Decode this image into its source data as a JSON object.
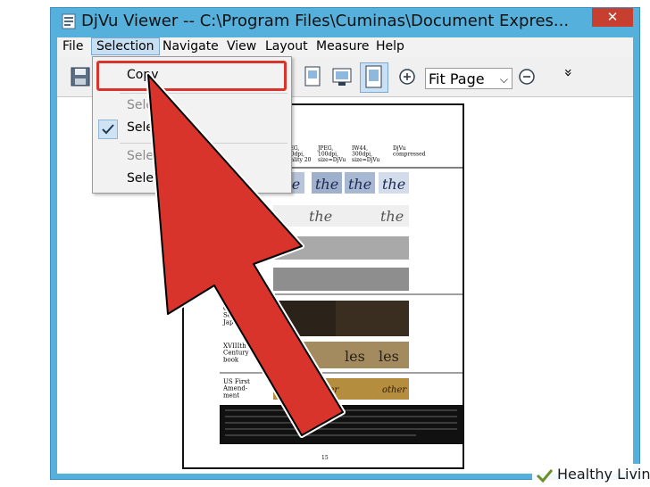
{
  "window": {
    "title": "DjVu Viewer -- C:\\Program Files\\Cuminas\\Document Expres...",
    "close_symbol": "✕"
  },
  "menubar": {
    "items": [
      "File",
      "Selection",
      "Navigate",
      "View",
      "Layout",
      "Measure",
      "Help"
    ]
  },
  "toolbar": {
    "zoom_value": "Fit Page",
    "zoom_chevron": "⌵",
    "overflow_symbol": "»"
  },
  "selection_menu": {
    "copy_label": "Copy",
    "item2_label": "Select",
    "item3_label": "Select",
    "item4_label": "Select",
    "item5_label": "Select"
  },
  "document": {
    "col1": "JPEG,\n300dpi,\nquality 20",
    "col2": "JPEG,\n100dpi,\nsize=DjVu",
    "col3": "IW44,\n300dpi,\nsize=DjVu",
    "col4": "DjVu\ncompressed",
    "row_words": [
      "the",
      "the",
      "the",
      "the",
      "the",
      "the"
    ],
    "row_les": "les",
    "row_other": "other",
    "row_labels": [
      "Cr\nSecti\nJapa",
      "XVIIIth\nCentury\nbook",
      "US First\nAmend-\nment"
    ],
    "page_number": "15"
  },
  "watermark": {
    "label": "Healthy Living"
  },
  "colors": {
    "window_frame": "#56b0dc",
    "close_button": "#c7402f",
    "cursor_red": "#d9342c",
    "highlight": "#d9342c"
  }
}
